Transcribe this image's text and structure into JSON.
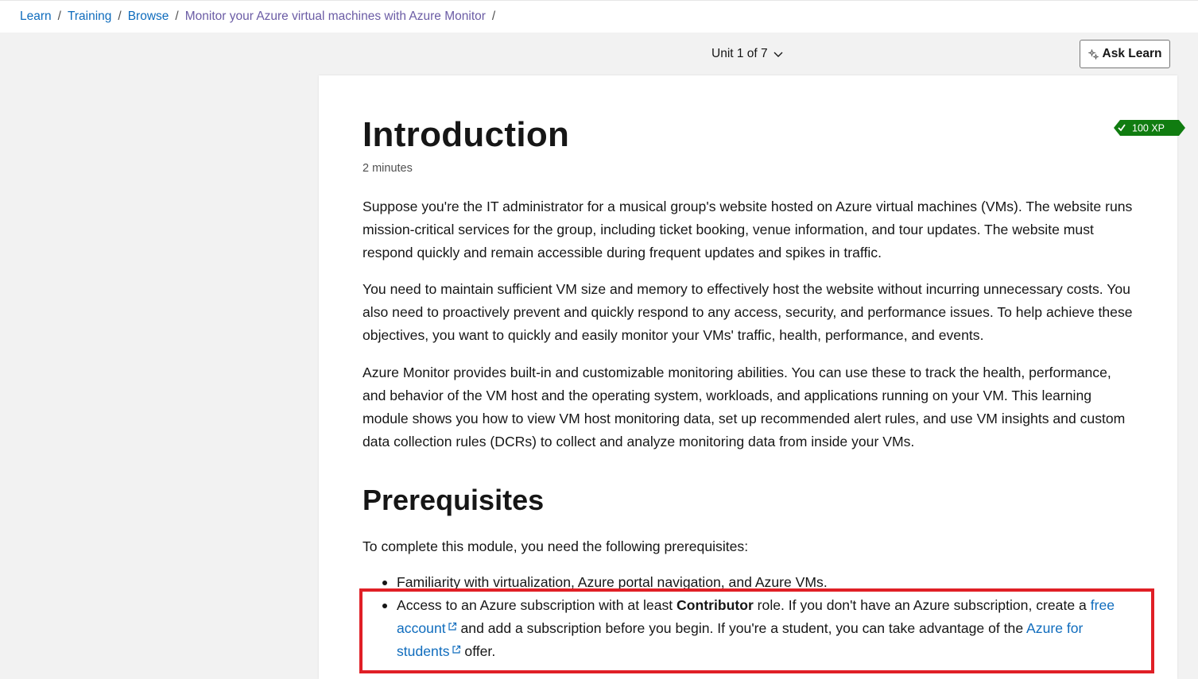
{
  "breadcrumb": {
    "items": [
      "Learn",
      "Training",
      "Browse",
      "Monitor your Azure virtual machines with Azure Monitor"
    ],
    "separator": "/"
  },
  "unit_nav": {
    "label": "Unit 1 of 7"
  },
  "ask_learn": {
    "label": "Ask Learn"
  },
  "unit": {
    "title": "Introduction",
    "duration": "2 minutes",
    "xp": "100 XP",
    "paragraphs": [
      "Suppose you're the IT administrator for a musical group's website hosted on Azure virtual machines (VMs). The website runs mission-critical services for the group, including ticket booking, venue information, and tour updates. The website must respond quickly and remain accessible during frequent updates and spikes in traffic.",
      "You need to maintain sufficient VM size and memory to effectively host the website without incurring unnecessary costs. You also need to proactively prevent and quickly respond to any access, security, and performance issues. To help achieve these objectives, you want to quickly and easily monitor your VMs' traffic, health, performance, and events.",
      "Azure Monitor provides built-in and customizable monitoring abilities. You can use these to track the health, performance, and behavior of the VM host and the operating system, workloads, and applications running on your VM. This learning module shows you how to view VM host monitoring data, set up recommended alert rules, and use VM insights and custom data collection rules (DCRs) to collect and analyze monitoring data from inside your VMs."
    ]
  },
  "prerequisites": {
    "heading": "Prerequisites",
    "intro": "To complete this module, you need the following prerequisites:",
    "item1": "Familiarity with virtualization, Azure portal navigation, and Azure VMs.",
    "item2": {
      "part1": "Access to an Azure subscription with at least ",
      "bold": "Contributor",
      "part2": " role. If you don't have an Azure subscription, create a ",
      "link1": "free account",
      "part3": " and add a subscription before you begin. If you're a student, you can take advantage of the ",
      "link2": "Azure for students",
      "part4": " offer."
    }
  },
  "colors": {
    "link": "#0f6cbd",
    "xp_badge": "#107c10",
    "highlight": "#e01f26"
  }
}
